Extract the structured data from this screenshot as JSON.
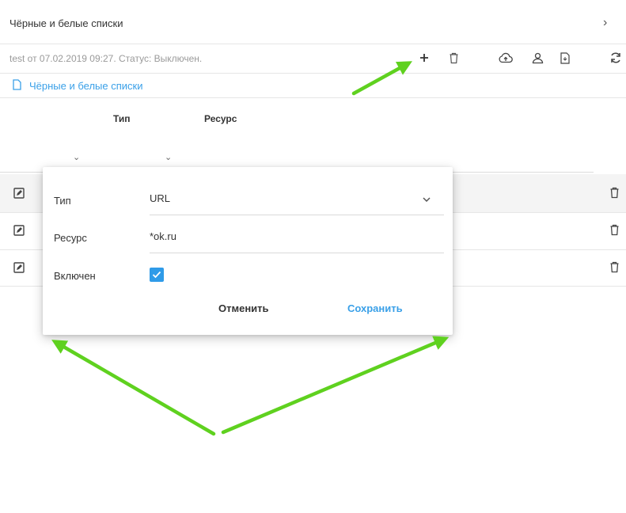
{
  "panel": {
    "title": "Чёрные и белые списки",
    "expand_glyph": "›"
  },
  "toolbar": {
    "status": "test от 07.02.2019 09:27. Статус: Выключен.",
    "icons": [
      "plus-icon",
      "trash-icon",
      "cloud-upload-icon",
      "users-icon",
      "file-icon",
      "refresh-icon"
    ]
  },
  "breadcrumb": {
    "label": "Чёрные и белые списки"
  },
  "table": {
    "columns": [
      {
        "label": "Тип"
      },
      {
        "label": "Ресурс"
      }
    ],
    "filter_glyph": "⌄",
    "rows": [
      {
        "highlighted": true
      },
      {
        "highlighted": false
      },
      {
        "highlighted": false
      }
    ]
  },
  "dialog": {
    "type_label": "Тип",
    "type_value": "URL",
    "resource_label": "Ресурс",
    "resource_value": "*ok.ru",
    "enabled_label": "Включен",
    "enabled_checked": true,
    "cancel_label": "Отменить",
    "save_label": "Сохранить"
  },
  "colors": {
    "accent": "#3aa0e8",
    "checkbox": "#2f9be8",
    "arrow": "#5fd11f"
  }
}
